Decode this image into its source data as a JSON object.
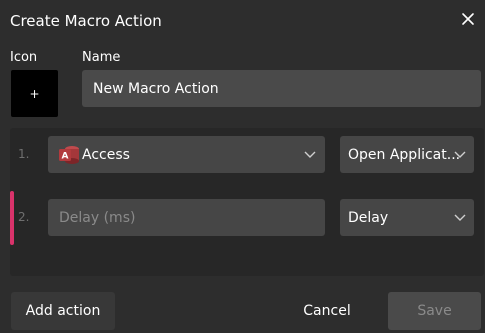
{
  "dialog": {
    "title": "Create Macro Action",
    "icon_label": "Icon",
    "icon_placeholder": "+",
    "name_label": "Name",
    "name_value": "New Macro Action"
  },
  "actions": [
    {
      "number": "1.",
      "app_icon": "microsoft-access-icon",
      "app_name": "Access",
      "action_type": "Open Applicat..."
    },
    {
      "number": "2.",
      "delay_placeholder": "Delay (ms)",
      "action_type": "Delay"
    }
  ],
  "footer": {
    "add_action_label": "Add action",
    "cancel_label": "Cancel",
    "save_label": "Save"
  },
  "colors": {
    "accent": "#d9336b",
    "background": "#2d2d2d",
    "field": "#464646",
    "access_red": "#a4373a"
  }
}
